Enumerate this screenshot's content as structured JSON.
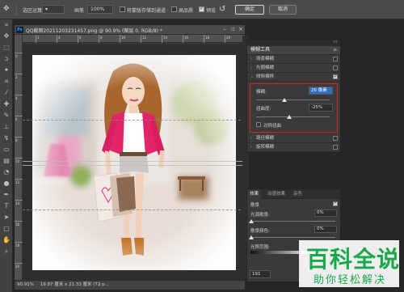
{
  "options_bar": {
    "mode_label": "选区运算",
    "size_label": "画笔",
    "size_value": "100%",
    "save_channel_label": "将蒙版存储到通道",
    "hq_label": "高品质",
    "preview_label": "预览",
    "ok_label": "确定",
    "cancel_label": "取消"
  },
  "document": {
    "title": "QQ截图20211203231457.png @ 90.9% (图层 0, RGB/8) *",
    "ps_badge": "Ps",
    "zoom": "90.91%",
    "doc_size": "19.87 厘米 x 21.33 厘米 (72 p..."
  },
  "ruler": {
    "top": [
      "2",
      "4",
      "6",
      "8",
      "10",
      "12",
      "14",
      "16",
      "18",
      "20"
    ],
    "left": [
      "0",
      "2",
      "4",
      "6",
      "8",
      "10",
      "12",
      "14",
      "16",
      "18",
      "20"
    ]
  },
  "blur_panel": {
    "title": "模糊工具",
    "rows": [
      {
        "label": "场景模糊",
        "checked": false
      },
      {
        "label": "光圈模糊",
        "checked": false
      },
      {
        "label": "倾斜偏移",
        "checked": true
      }
    ],
    "blur_label": "模糊:",
    "blur_value": "26 像素",
    "distortion_label": "扭曲度:",
    "distortion_value": "-25%",
    "symmetric_label": "对称扭曲",
    "rows_after": [
      {
        "label": "路径模糊",
        "checked": false
      },
      {
        "label": "旋转模糊",
        "checked": false
      }
    ]
  },
  "effects_panel": {
    "tabs": [
      "效果",
      "动感效果",
      "杂色"
    ],
    "bokeh_label": "散景",
    "light_bokeh_label": "光源散景:",
    "light_bokeh_value": "0%",
    "bokeh_color_label": "散景颜色:",
    "bokeh_color_value": "0%",
    "light_range_label": "光照范围:",
    "range_value": "191"
  },
  "watermark": {
    "main": "百科全说",
    "sub": "助你轻松解决"
  },
  "colors": {
    "highlight_red": "#d32222",
    "watermark_green": "#18a84a",
    "selection_blue": "#2d6bc4"
  }
}
